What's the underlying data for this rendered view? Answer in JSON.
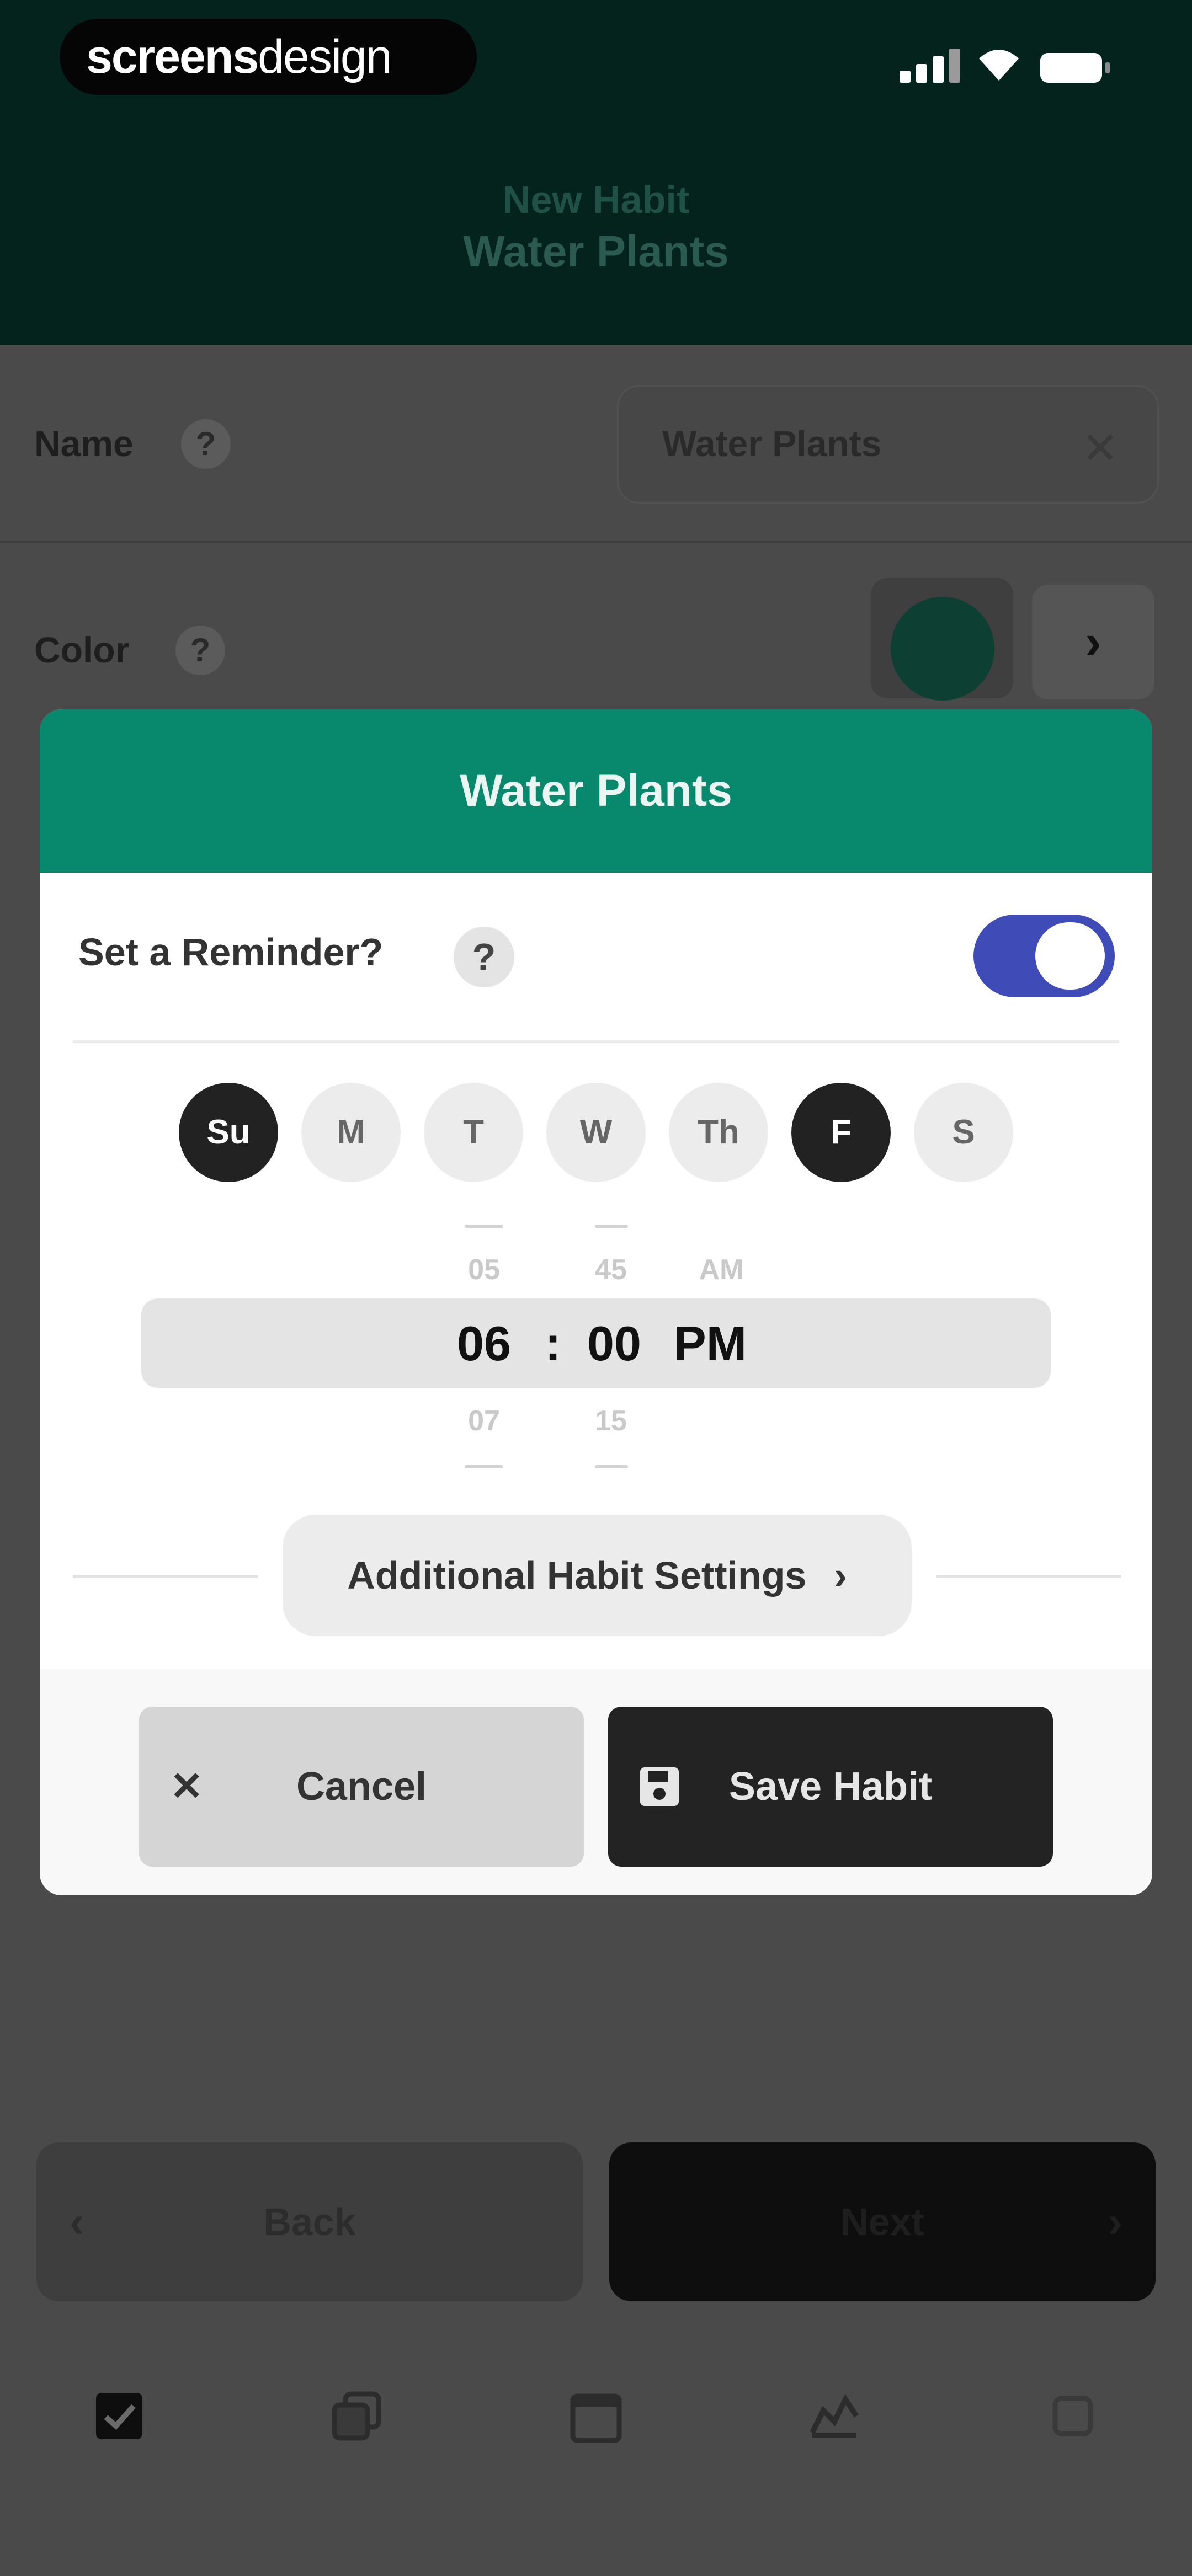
{
  "brand": {
    "bold": "screens",
    "light": "design"
  },
  "header": {
    "subtitle": "New Habit",
    "title": "Water Plants"
  },
  "form": {
    "name_label": "Name",
    "name_help": "?",
    "name_value": "Water Plants",
    "clear_symbol": "✕",
    "color_label": "Color",
    "color_help": "?",
    "color_value": "#0d3f33",
    "color_next": "›"
  },
  "modal": {
    "title": "Water Plants",
    "reminder_label": "Set a Reminder?",
    "reminder_help": "?",
    "reminder_on": true,
    "days": [
      {
        "label": "Su",
        "selected": true
      },
      {
        "label": "M",
        "selected": false
      },
      {
        "label": "T",
        "selected": false
      },
      {
        "label": "W",
        "selected": false
      },
      {
        "label": "Th",
        "selected": false
      },
      {
        "label": "F",
        "selected": true
      },
      {
        "label": "S",
        "selected": false
      }
    ],
    "time": {
      "hour_prev": "05",
      "hour": "06",
      "hour_next": "07",
      "separator": ":",
      "minute_prev": "45",
      "minute": "00",
      "minute_next": "15",
      "period_prev": "AM",
      "period": "PM"
    },
    "additional_settings": "Additional Habit Settings",
    "additional_chevron": "›",
    "cancel": {
      "icon": "close-icon",
      "label": "Cancel"
    },
    "save": {
      "icon": "save-icon",
      "label": "Save Habit"
    }
  },
  "nav": {
    "back": "Back",
    "next": "Next"
  },
  "tabbar": {
    "items": [
      "checklist-icon",
      "copy-icon",
      "calendar-icon",
      "stats-icon",
      "settings-icon"
    ]
  },
  "colors": {
    "header": "#04231d",
    "accent": "#08896d",
    "toggle": "#3f4bb7"
  }
}
